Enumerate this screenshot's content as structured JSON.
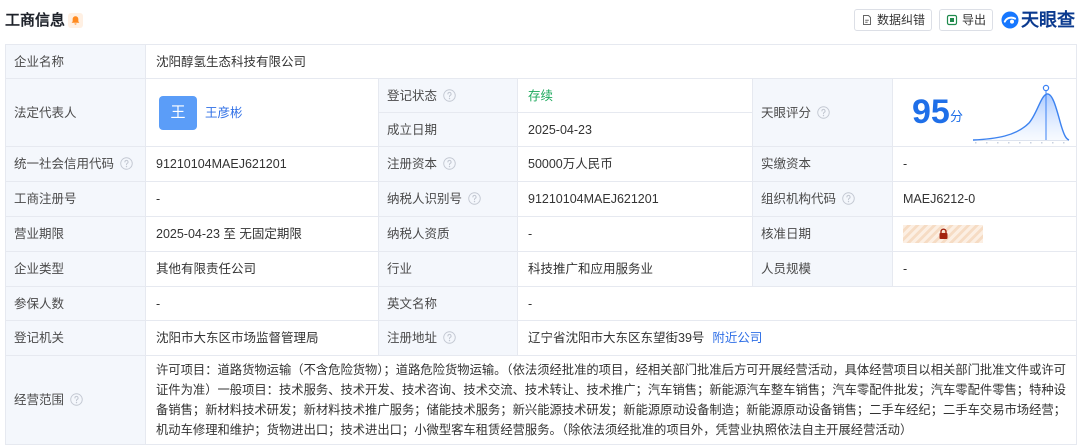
{
  "header": {
    "title": "工商信息",
    "correct_button": "数据纠错",
    "export_button": "导出",
    "brand": "天眼查"
  },
  "colors": {
    "title_text": "#1d2129",
    "label_bg": "#f4f7fc",
    "border": "#e6e9f0",
    "link_blue": "#2f6fe6",
    "score_blue": "#1f6fe8",
    "status_green": "#1ca85c",
    "avatar_blue": "#5b9df8",
    "bell_orange": "#ff8a1f",
    "lock_red": "#a3230e",
    "brand_navy": "#0b3a8f"
  },
  "icons": {
    "bell": "bell-icon",
    "correct": "edit-document-icon",
    "export": "export-icon",
    "brand": "tianyancha-logo-icon",
    "info": "info-icon",
    "lock": "lock-icon"
  },
  "company_name": {
    "label": "企业名称",
    "value": "沈阳醇氢生态科技有限公司"
  },
  "legal_representative": {
    "label": "法定代表人",
    "avatar": "王",
    "name": "王彦彬"
  },
  "registration_status": {
    "label": "登记状态",
    "value": "存续"
  },
  "established_date": {
    "label": "成立日期",
    "value": "2025-04-23"
  },
  "tianyan_score": {
    "label": "天眼评分",
    "value": "95",
    "unit": "分"
  },
  "credit_code": {
    "label": "统一社会信用代码",
    "value": "91210104MAEJ621201"
  },
  "registered_capital": {
    "label": "注册资本",
    "value": "50000万人民币"
  },
  "paid_in_capital": {
    "label": "实缴资本",
    "value": "-"
  },
  "business_reg_no": {
    "label": "工商注册号",
    "value": "-"
  },
  "taxpayer_id": {
    "label": "纳税人识别号",
    "value": "91210104MAEJ621201"
  },
  "org_code": {
    "label": "组织机构代码",
    "value": "MAEJ6212-0"
  },
  "business_term": {
    "label": "营业期限",
    "value": "2025-04-23 至 无固定期限"
  },
  "taxpayer_qualification": {
    "label": "纳税人资质",
    "value": "-"
  },
  "approval_date": {
    "label": "核准日期",
    "locked": true
  },
  "company_type": {
    "label": "企业类型",
    "value": "其他有限责任公司"
  },
  "industry": {
    "label": "行业",
    "value": "科技推广和应用服务业"
  },
  "staff_size": {
    "label": "人员规模",
    "value": "-"
  },
  "insured_count": {
    "label": "参保人数",
    "value": "-"
  },
  "english_name": {
    "label": "英文名称",
    "value": "-"
  },
  "registration_authority": {
    "label": "登记机关",
    "value": "沈阳市大东区市场监督管理局"
  },
  "registered_address": {
    "label": "注册地址",
    "value": "辽宁省沈阳市大东区东望街39号",
    "link": "附近公司"
  },
  "business_scope": {
    "label": "经营范围",
    "value": "许可项目：道路货物运输（不含危险货物）；道路危险货物运输。（依法须经批准的项目，经相关部门批准后方可开展经营活动，具体经营项目以相关部门批准文件或许可证件为准）一般项目：技术服务、技术开发、技术咨询、技术交流、技术转让、技术推广；汽车销售；新能源汽车整车销售；汽车零配件批发；汽车零配件零售；特种设备销售；新材料技术研发；新材料技术推广服务；储能技术服务；新兴能源技术研发；新能源原动设备制造；新能源原动设备销售；二手车经纪；二手车交易市场经营；机动车修理和维护；货物进出口；技术进出口；小微型客车租赁经营服务。（除依法须经批准的项目外，凭营业执照依法自主开展经营活动）"
  }
}
